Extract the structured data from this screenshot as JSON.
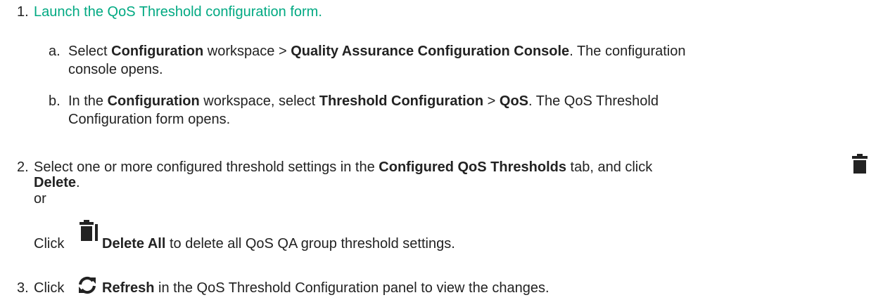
{
  "colors": {
    "link": "#01a982",
    "text": "#222222",
    "icon": "#222222"
  },
  "step1": {
    "number": "1.",
    "link_text": "Launch the QoS Threshold configuration form.",
    "a": {
      "letter": "a.",
      "t1": "Select ",
      "b1": "Configuration",
      "t2": " workspace > ",
      "b2": "Quality Assurance Configuration Console",
      "t3": ". The configuration",
      "t4": "console opens."
    },
    "b": {
      "letter": "b.",
      "t1": "In the ",
      "b1": "Configuration",
      "t2": " workspace, select ",
      "b2": "Threshold Configuration",
      "t3": " > ",
      "b3": "QoS",
      "t4": ". The QoS Threshold",
      "t5": "Configuration form opens."
    }
  },
  "step2": {
    "number": "2.",
    "t1": "Select one or more configured threshold settings in the ",
    "b1": "Configured QoS Thresholds",
    "t2": " tab, and click",
    "delete_label": "Delete",
    "t3": ".",
    "or": "or",
    "click": "Click ",
    "delete_all_label": "Delete All",
    "t4": " to delete all QoS QA group threshold settings.",
    "icons": {
      "delete": "trash-icon",
      "delete_all": "trash-all-icon"
    }
  },
  "step3": {
    "number": "3.",
    "click": "Click ",
    "refresh_label": "Refresh",
    "t1": " in the QoS Threshold Configuration panel to view the changes.",
    "icon": "refresh-icon"
  }
}
